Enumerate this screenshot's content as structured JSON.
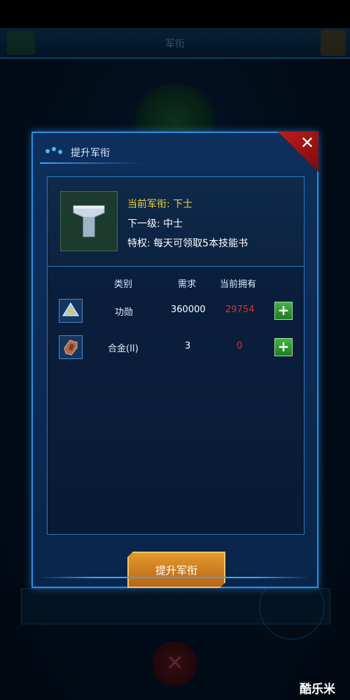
{
  "background": {
    "header_title": "军衔"
  },
  "dialog": {
    "title": "提升军衔",
    "close_icon": "close-x",
    "info": {
      "current_rank": "当前军衔: 下士",
      "next_rank": "下一级: 中士",
      "privilege": "特权: 每天可领取5本技能书"
    },
    "table": {
      "headers": {
        "category": "类别",
        "required": "需求",
        "owned": "当前拥有"
      },
      "rows": [
        {
          "icon": "merit-crystal-icon",
          "category": "功勋",
          "required": "360000",
          "owned": "29754"
        },
        {
          "icon": "alloy-icon",
          "category": "合金(II)",
          "required": "3",
          "owned": "0"
        }
      ]
    },
    "promote_button": "提升军衔"
  },
  "watermark": "酷乐米",
  "colors": {
    "accent": "#2b8fe0",
    "insufficient": "#e0302b",
    "current_rank": "#f6d240",
    "button": "#e39a2a"
  }
}
